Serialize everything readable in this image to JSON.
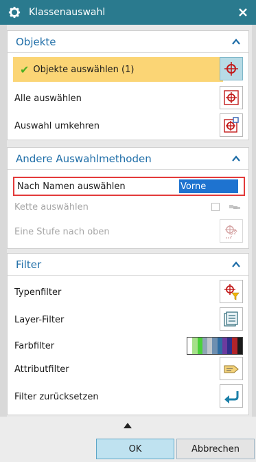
{
  "window": {
    "title": "Klassenauswahl"
  },
  "groups": {
    "objects": {
      "title": "Objekte",
      "items": [
        {
          "label": "Objekte auswählen (1)"
        },
        {
          "label": "Alle auswählen"
        },
        {
          "label": "Auswahl umkehren"
        }
      ]
    },
    "other": {
      "title": "Andere Auswahlmethoden",
      "name_select_label": "Nach Namen auswählen",
      "name_value": "Vorne",
      "chain_label": "Kette auswählen",
      "level_up_label": "Eine Stufe nach oben"
    },
    "filter": {
      "title": "Filter",
      "items": [
        {
          "label": "Typenfilter"
        },
        {
          "label": "Layer-Filter"
        },
        {
          "label": "Farbfilter"
        },
        {
          "label": "Attributfilter"
        },
        {
          "label": "Filter zurücksetzen"
        }
      ],
      "color_swatches": [
        "#ffffff",
        "#a6e08a",
        "#4ad13a",
        "#8fa5b5",
        "#c0c6cc",
        "#6e8fb0",
        "#2f6da3",
        "#6d3b9e",
        "#2f2f8a",
        "#b2242a",
        "#1a1a1a"
      ]
    }
  },
  "buttons": {
    "ok": "OK",
    "cancel": "Abbrechen"
  },
  "colors": {
    "title_bar": "#2a7a8e",
    "selected_row": "#fbd575",
    "accent": "#1f6ea8",
    "highlight_border": "#e33a3a"
  }
}
